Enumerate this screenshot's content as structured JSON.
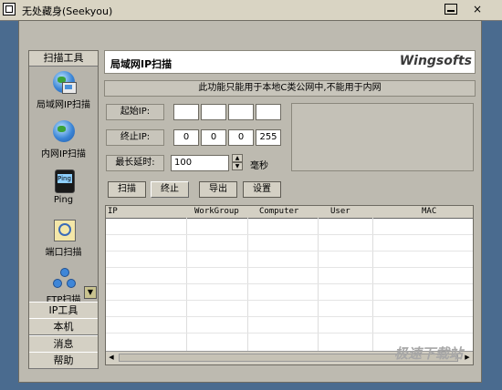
{
  "window": {
    "title": "无处藏身(Seekyou)",
    "close_glyph": "×"
  },
  "sidebar": {
    "header": "扫描工具",
    "tools": [
      {
        "label": "局域网IP扫描",
        "icon": "network-globe-icon"
      },
      {
        "label": "内网IP扫描",
        "icon": "globe-icon"
      },
      {
        "label": "Ping",
        "icon": "ping-device-icon"
      },
      {
        "label": "端口扫描",
        "icon": "magnifier-icon"
      },
      {
        "label": "FTP扫描",
        "icon": "network-nodes-icon"
      }
    ],
    "scroll_glyph": "▼",
    "tabs": [
      "IP工具",
      "本机",
      "消息",
      "帮助"
    ]
  },
  "main": {
    "title": "局域网IP扫描",
    "brand": "Wingsofts",
    "notice": "此功能只能用于本地C类公网中,不能用于内网",
    "start_ip": {
      "label": "起始IP:",
      "octets": [
        "",
        "",
        "",
        ""
      ]
    },
    "end_ip": {
      "label": "终止IP:",
      "octets": [
        "0",
        "0",
        "0",
        "255"
      ]
    },
    "delay": {
      "label": "最长延时:",
      "value": "100",
      "unit": "毫秒"
    },
    "buttons": {
      "scan": "扫描",
      "stop": "终止",
      "export": "导出",
      "settings": "设置"
    },
    "table": {
      "columns": [
        "IP",
        "WorkGroup",
        "Computer",
        "User",
        "MAC"
      ],
      "rows": []
    }
  },
  "watermark": "极速下载站"
}
